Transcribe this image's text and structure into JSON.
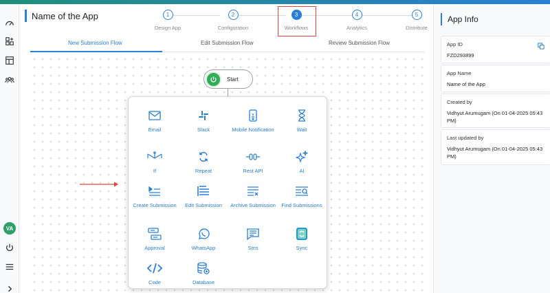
{
  "app": {
    "title": "Name of the App"
  },
  "stepper": {
    "steps": [
      {
        "num": "1",
        "label": "Design App"
      },
      {
        "num": "2",
        "label": "Configuration"
      },
      {
        "num": "3",
        "label": "Workflows"
      },
      {
        "num": "4",
        "label": "Analytics"
      },
      {
        "num": "5",
        "label": "Distribute"
      }
    ]
  },
  "tabs": [
    {
      "label": "New Submission Flow"
    },
    {
      "label": "Edit Submission Flow"
    },
    {
      "label": "Review Submission Flow"
    }
  ],
  "start": {
    "label": "Start"
  },
  "actions": [
    {
      "label": "Email",
      "icon": "email-icon"
    },
    {
      "label": "Slack",
      "icon": "slack-icon"
    },
    {
      "label": "Mobile Notification",
      "icon": "mobile-notification-icon"
    },
    {
      "label": "Wait",
      "icon": "hourglass-icon"
    },
    {
      "label": "If",
      "icon": "branch-icon"
    },
    {
      "label": "Repeat",
      "icon": "repeat-icon"
    },
    {
      "label": "Rest API",
      "icon": "api-icon"
    },
    {
      "label": "AI",
      "icon": "sparkle-icon"
    },
    {
      "label": "Create Submission",
      "icon": "create-submission-icon"
    },
    {
      "label": "Edit Submission",
      "icon": "edit-submission-icon"
    },
    {
      "label": "Archive Submission",
      "icon": "archive-submission-icon"
    },
    {
      "label": "Find Submissions",
      "icon": "find-submissions-icon"
    },
    {
      "label": "Approval",
      "icon": "approval-icon"
    },
    {
      "label": "WhatsApp",
      "icon": "whatsapp-icon"
    },
    {
      "label": "Sms",
      "icon": "sms-icon"
    },
    {
      "label": "Sync",
      "icon": "sync-icon"
    },
    {
      "label": "Code",
      "icon": "code-icon"
    },
    {
      "label": "Database",
      "icon": "database-icon"
    }
  ],
  "user": {
    "initials": "VA"
  },
  "info": {
    "title": "App Info",
    "app_id_key": "App ID",
    "app_id": "FZD293899",
    "app_name_key": "App Name",
    "app_name": "Name of the App",
    "created_key": "Created by",
    "created": "Vidhyut Arumugam (On 01-04-2025 05:43 PM)",
    "updated_key": "Last updated by",
    "updated": "Vidhyut Arumugam (On 01-04-2025 05:43 PM)"
  },
  "colors": {
    "accent": "#2a7fd4",
    "start_green": "#2fae56",
    "highlight_red": "#e0463a"
  }
}
